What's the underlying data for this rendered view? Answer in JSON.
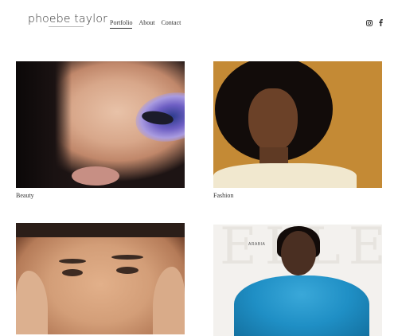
{
  "brand": {
    "name": "phoebe taylor"
  },
  "nav": {
    "items": [
      {
        "label": "Portfolio"
      },
      {
        "label": "About"
      },
      {
        "label": "Contact"
      }
    ]
  },
  "social": {
    "icons": [
      "instagram-icon",
      "facebook-icon"
    ]
  },
  "portfolio": {
    "tiles": [
      {
        "caption": "Beauty"
      },
      {
        "caption": "Fashion"
      },
      {
        "caption": ""
      },
      {
        "caption": "",
        "magazine": {
          "masthead": "ELLE",
          "edition": "ARABIA"
        }
      }
    ]
  },
  "colors": {
    "text": "#333333",
    "background": "#ffffff"
  }
}
